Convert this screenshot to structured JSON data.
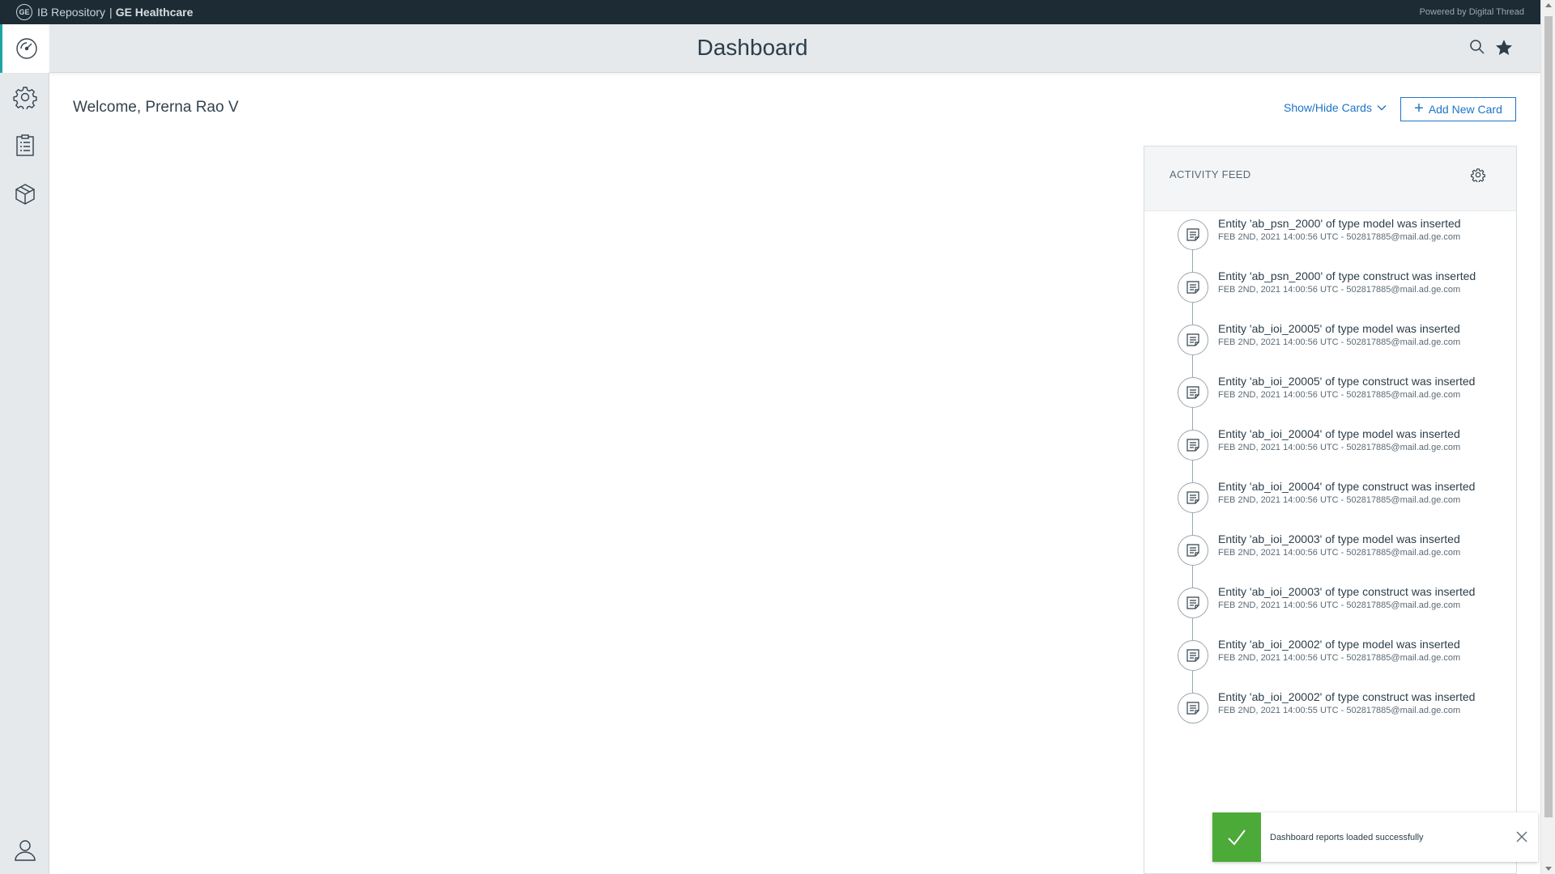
{
  "topbar": {
    "logo_text": "GE",
    "app_name": "IB Repository",
    "separator": "|",
    "brand": "GE Healthcare",
    "powered": "Powered by Digital Thread"
  },
  "leftnav": {
    "items": [
      {
        "icon": "speedometer-icon",
        "active": true
      },
      {
        "icon": "gear-icon",
        "active": false
      },
      {
        "icon": "checklist-icon",
        "active": false
      },
      {
        "icon": "cube-icon",
        "active": false
      }
    ],
    "profile_icon": "user-icon"
  },
  "header": {
    "title": "Dashboard",
    "icons": [
      "search-icon",
      "star-icon"
    ]
  },
  "main": {
    "welcome": "Welcome, Prerna Rao V",
    "show_hide_label": "Show/Hide Cards",
    "add_card_label": "Add New Card"
  },
  "activity_feed": {
    "title": "ACTIVITY FEED",
    "items": [
      {
        "message": "Entity 'ab_psn_2000' of type model was inserted",
        "meta": "FEB 2ND, 2021 14:00:56 UTC - 502817885@mail.ad.ge.com"
      },
      {
        "message": "Entity 'ab_psn_2000' of type construct was inserted",
        "meta": "FEB 2ND, 2021 14:00:56 UTC - 502817885@mail.ad.ge.com"
      },
      {
        "message": "Entity 'ab_ioi_20005' of type model was inserted",
        "meta": "FEB 2ND, 2021 14:00:56 UTC - 502817885@mail.ad.ge.com"
      },
      {
        "message": "Entity 'ab_ioi_20005' of type construct was inserted",
        "meta": "FEB 2ND, 2021 14:00:56 UTC - 502817885@mail.ad.ge.com"
      },
      {
        "message": "Entity 'ab_ioi_20004' of type model was inserted",
        "meta": "FEB 2ND, 2021 14:00:56 UTC - 502817885@mail.ad.ge.com"
      },
      {
        "message": "Entity 'ab_ioi_20004' of type construct was inserted",
        "meta": "FEB 2ND, 2021 14:00:56 UTC - 502817885@mail.ad.ge.com"
      },
      {
        "message": "Entity 'ab_ioi_20003' of type model was inserted",
        "meta": "FEB 2ND, 2021 14:00:56 UTC - 502817885@mail.ad.ge.com"
      },
      {
        "message": "Entity 'ab_ioi_20003' of type construct was inserted",
        "meta": "FEB 2ND, 2021 14:00:56 UTC - 502817885@mail.ad.ge.com"
      },
      {
        "message": "Entity 'ab_ioi_20002' of type model was inserted",
        "meta": "FEB 2ND, 2021 14:00:56 UTC - 502817885@mail.ad.ge.com"
      },
      {
        "message": "Entity 'ab_ioi_20002' of type construct was inserted",
        "meta": "FEB 2ND, 2021 14:00:55 UTC - 502817885@mail.ad.ge.com"
      }
    ]
  },
  "toast": {
    "message": "Dashboard reports loaded successfully",
    "status_color": "#4caa38"
  },
  "colors": {
    "topbar": "#1d2b35",
    "accent": "#1e74c6",
    "active_nav": "#1ea3a3"
  }
}
